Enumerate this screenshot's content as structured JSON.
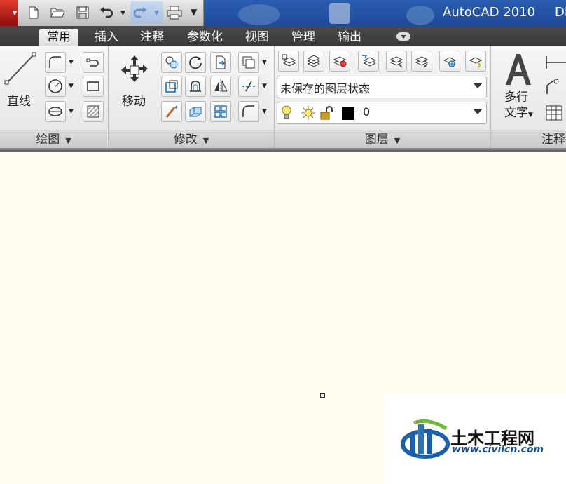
{
  "window": {
    "title": "AutoCAD 2010",
    "title_extra": "DI"
  },
  "ribbon_tabs": [
    {
      "label": "常用",
      "active": true
    },
    {
      "label": "插入"
    },
    {
      "label": "注释"
    },
    {
      "label": "参数化"
    },
    {
      "label": "视图"
    },
    {
      "label": "管理"
    },
    {
      "label": "输出"
    }
  ],
  "draw_panel": {
    "line_label": "直线",
    "panel_label": "绘图"
  },
  "modify_panel": {
    "move_label": "移动",
    "panel_label": "修改"
  },
  "layers_panel": {
    "layer_state_value": "未保存的图层状态",
    "layer_value": "0",
    "panel_label": "图层"
  },
  "annotation_panel": {
    "mtext_label_1": "多行",
    "mtext_label_2": "文字",
    "panel_label": "注释"
  },
  "watermark": {
    "title": "土木工程网",
    "url": "www.civilcn.com"
  },
  "colors": {
    "canvas": "#fffcf0",
    "title_bar": "#1d4a98",
    "tab_bar": "#3a3a3a"
  }
}
